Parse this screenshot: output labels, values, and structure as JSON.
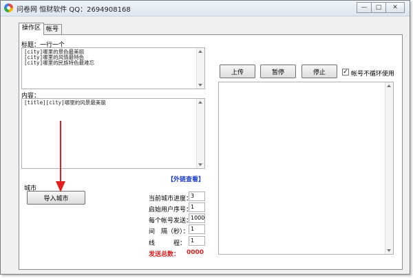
{
  "window": {
    "title": "问卷网  恒财软件 QQ：2694908168",
    "minimize_glyph": "—",
    "maximize_glyph": "□",
    "close_glyph": "✕"
  },
  "tabs": [
    {
      "label": "操作区",
      "active": true
    },
    {
      "label": "帐号",
      "active": false
    }
  ],
  "title_section": {
    "label": "标题：一行一个",
    "lines": [
      "[city]哪里的景色最美丽",
      "[city]哪里的风情最特色",
      "[city]哪里的民族特色最难忘"
    ]
  },
  "content_section": {
    "label": "内容：",
    "text": "[title][city]哪里的风景最美丽"
  },
  "external_link": "【外链查看】",
  "city_section": {
    "label": "城市",
    "import_button": "导入城市"
  },
  "settings": {
    "current_city_progress": {
      "label": "当前城市进度：",
      "value": "3"
    },
    "start_user_index": {
      "label": "启始用户序号：",
      "value": "1"
    },
    "per_account_send": {
      "label": "每个帐号发送：",
      "value": "1000"
    },
    "interval": {
      "label": "间　隔（秒）：",
      "value": "1"
    },
    "threads": {
      "label": "线　　　程：",
      "value": "1"
    }
  },
  "total_sent": {
    "label": "发送总数：",
    "value": "0000"
  },
  "controls": {
    "upload": "上传",
    "pause": "暂停",
    "stop": "停止",
    "no_cycle_label": "帐号不循环使用",
    "no_cycle_checked": true,
    "check_glyph": "✓"
  },
  "annotation_arrow_color": "#e02020"
}
